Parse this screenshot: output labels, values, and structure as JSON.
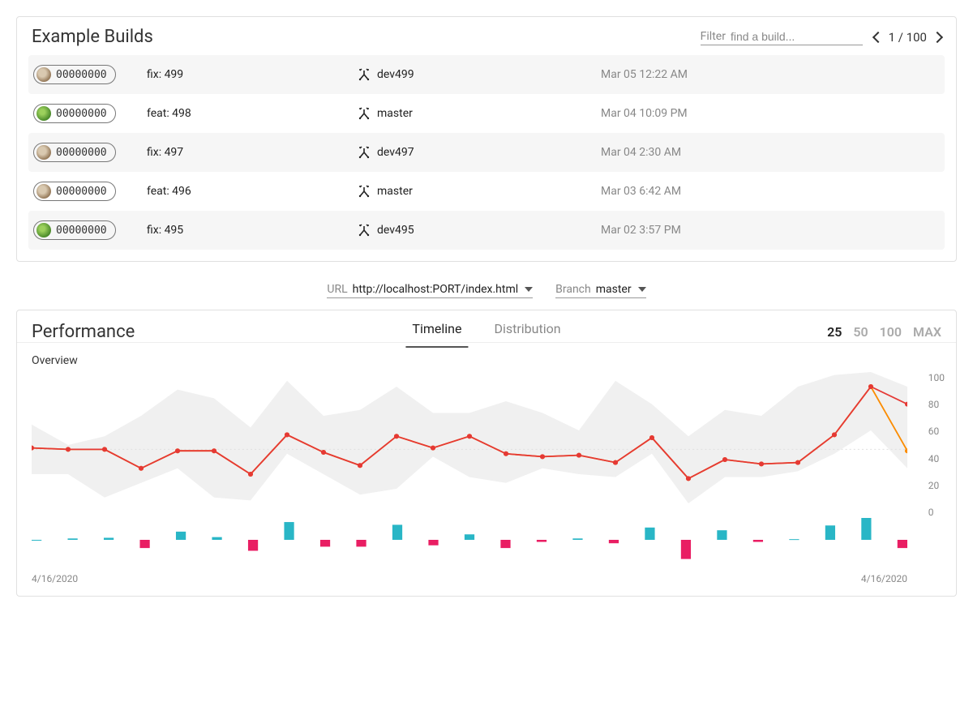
{
  "builds_card": {
    "title": "Example Builds",
    "filter_label": "Filter",
    "filter_placeholder": "find a build...",
    "pager_text": "1 / 100",
    "rows": [
      {
        "hash": "00000000",
        "msg": "fix: 499",
        "branch": "dev499",
        "date": "Mar 05 12:22 AM",
        "avatar": "avatar1"
      },
      {
        "hash": "00000000",
        "msg": "feat: 498",
        "branch": "master",
        "date": "Mar 04 10:09 PM",
        "avatar": "avatar2"
      },
      {
        "hash": "00000000",
        "msg": "fix: 497",
        "branch": "dev497",
        "date": "Mar 04 2:30 AM",
        "avatar": "avatar1"
      },
      {
        "hash": "00000000",
        "msg": "feat: 496",
        "branch": "master",
        "date": "Mar 03 6:42 AM",
        "avatar": "avatar1"
      },
      {
        "hash": "00000000",
        "msg": "fix: 495",
        "branch": "dev495",
        "date": "Mar 02 3:57 PM",
        "avatar": "avatar2"
      }
    ]
  },
  "filters": {
    "url_label": "URL",
    "url_value": "http://localhost:PORT/index.html",
    "branch_label": "Branch",
    "branch_value": "master"
  },
  "perf_card": {
    "title": "Performance",
    "tabs": {
      "timeline": "Timeline",
      "distribution": "Distribution"
    },
    "active_tab": "timeline",
    "ranges": [
      "25",
      "50",
      "100",
      "MAX"
    ],
    "active_range": "25",
    "overview_label": "Overview",
    "xlabel_left": "4/16/2020",
    "xlabel_right": "4/16/2020"
  },
  "chart_data": {
    "type": "line",
    "ylim": [
      0,
      100
    ],
    "yticks": [
      0,
      20,
      40,
      60,
      80,
      100
    ],
    "x": [
      0,
      1,
      2,
      3,
      4,
      5,
      6,
      7,
      8,
      9,
      10,
      11,
      12,
      13,
      14,
      15,
      16,
      17,
      18,
      19,
      20,
      21,
      22,
      23,
      24
    ],
    "series": [
      {
        "name": "band_upper",
        "role": "area-upper",
        "values": [
          64,
          50,
          56,
          70,
          88,
          82,
          62,
          94,
          70,
          74,
          90,
          72,
          72,
          80,
          72,
          60,
          94,
          78,
          56,
          74,
          70,
          90,
          98,
          100,
          90
        ]
      },
      {
        "name": "band_lower",
        "role": "area-lower",
        "values": [
          30,
          30,
          14,
          24,
          34,
          14,
          12,
          44,
          30,
          16,
          20,
          42,
          28,
          24,
          34,
          30,
          28,
          44,
          10,
          28,
          28,
          32,
          44,
          60,
          34
        ]
      },
      {
        "name": "series_red",
        "color": "#e53935",
        "values": [
          48,
          47,
          47,
          34,
          46,
          46,
          30,
          57,
          45,
          36,
          56,
          48,
          56,
          44,
          42,
          43,
          38,
          55,
          27,
          40,
          37,
          38,
          57,
          90,
          78
        ]
      },
      {
        "name": "series_orange",
        "color": "#fb8c00",
        "values": [
          48,
          47,
          47,
          34,
          46,
          46,
          30,
          57,
          45,
          36,
          56,
          48,
          56,
          44,
          42,
          43,
          38,
          55,
          27,
          40,
          37,
          38,
          57,
          90,
          46
        ]
      }
    ],
    "diff_bars": {
      "positive_color": "#29b6c6",
      "negative_color": "#e91e63",
      "values": [
        0,
        2,
        3,
        -12,
        12,
        4,
        -16,
        26,
        -10,
        -10,
        22,
        -8,
        8,
        -12,
        -3,
        2,
        -5,
        18,
        -28,
        14,
        -3,
        1,
        21,
        32,
        -12
      ]
    }
  }
}
